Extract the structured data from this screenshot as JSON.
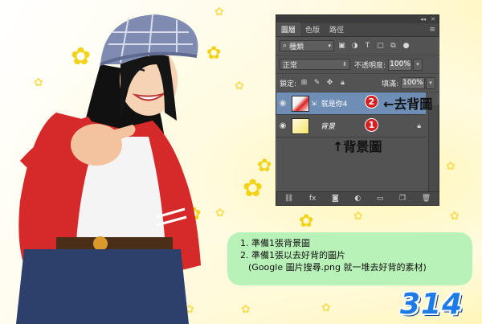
{
  "panel": {
    "tabs": [
      "圖層",
      "色版",
      "路徑"
    ],
    "filter_label": "種類",
    "blend_mode": "正常",
    "opacity_label": "不透明度:",
    "opacity_value": "100%",
    "lock_label": "鎖定:",
    "fill_label": "填滿:",
    "fill_value": "100%",
    "layers": [
      {
        "name": "就是你4",
        "visible": true,
        "selected": true
      },
      {
        "name": "背景",
        "visible": true,
        "selected": false,
        "locked": true
      }
    ]
  },
  "annotations": {
    "badge1": "1",
    "badge2": "2",
    "arrow_remove_bg": "←去背圖",
    "arrow_background": "↑背景圖"
  },
  "note": {
    "line1": "1. 準備1張背景圖",
    "line2": "2. 準備1張以去好背的圖片",
    "line3": "(Google 圖片搜尋.png 就一堆去好背的素材)"
  },
  "watermark": "314",
  "colors": {
    "badge": "#d81e1e",
    "note_bg": "#b9f2b9",
    "selected_layer": "#6f8eb5"
  }
}
